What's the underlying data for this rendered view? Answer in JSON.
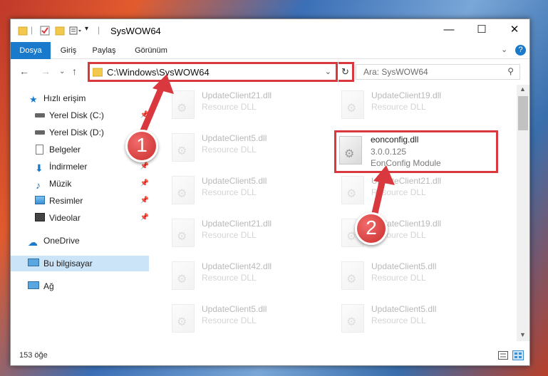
{
  "window": {
    "title": "SysWOW64"
  },
  "ribbon": {
    "tabs": [
      "Dosya",
      "Giriş",
      "Paylaş",
      "Görünüm"
    ]
  },
  "address": {
    "path": "C:\\Windows\\SysWOW64"
  },
  "search": {
    "placeholder": "Ara: SysWOW64"
  },
  "sidebar": {
    "items": [
      {
        "label": "Hızlı erişim",
        "icon": "star-icon"
      },
      {
        "label": "Yerel Disk (C:)",
        "icon": "drive-icon"
      },
      {
        "label": "Yerel Disk (D:)",
        "icon": "drive-icon"
      },
      {
        "label": "Belgeler",
        "icon": "documents-icon"
      },
      {
        "label": "İndirmeler",
        "icon": "download-icon"
      },
      {
        "label": "Müzik",
        "icon": "music-icon"
      },
      {
        "label": "Resimler",
        "icon": "pictures-icon"
      },
      {
        "label": "Videolar",
        "icon": "video-icon"
      },
      {
        "label": "OneDrive",
        "icon": "cloud-icon"
      },
      {
        "label": "Bu bilgisayar",
        "icon": "computer-icon"
      },
      {
        "label": "Ağ",
        "icon": "network-icon"
      }
    ]
  },
  "files": [
    {
      "name": "UpdateClient21.dll",
      "desc": "Resource DLL"
    },
    {
      "name": "UpdateClient19.dll",
      "desc": "Resource DLL"
    },
    {
      "name": "UpdateClient5.dll",
      "desc": "Resource DLL"
    },
    {
      "name": "eonconfig.dll",
      "version": "3.0.0.125",
      "desc": "EonConfig Module"
    },
    {
      "name": "UpdateClient5.dll",
      "desc": "Resource DLL"
    },
    {
      "name": "UpdateClient21.dll",
      "desc": "Resource DLL"
    },
    {
      "name": "UpdateClient21.dll",
      "desc": "Resource DLL"
    },
    {
      "name": "UpdateClient19.dll",
      "desc": "Resource DLL"
    },
    {
      "name": "UpdateClient42.dll",
      "desc": "Resource DLL"
    },
    {
      "name": "UpdateClient5.dll",
      "desc": "Resource DLL"
    },
    {
      "name": "UpdateClient5.dll",
      "desc": "Resource DLL"
    },
    {
      "name": "UpdateClient5.dll",
      "desc": "Resource DLL"
    }
  ],
  "status": {
    "count": "153 öğe"
  },
  "callouts": [
    "1",
    "2"
  ],
  "colors": {
    "accent": "#1979ca",
    "highlight": "#d9393e",
    "selected": "#cce4f7"
  }
}
